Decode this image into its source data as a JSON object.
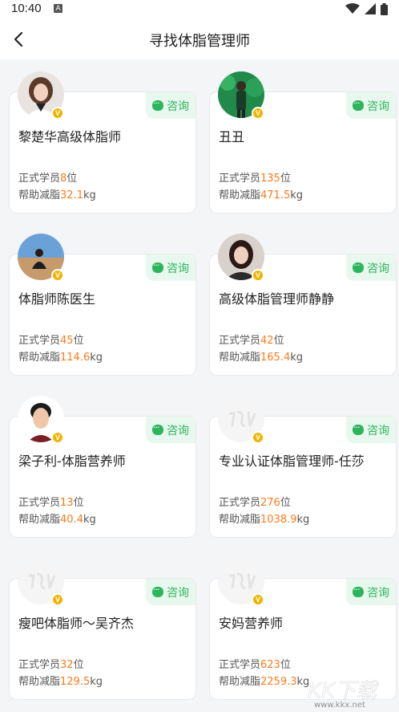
{
  "status": {
    "time": "10:40",
    "app_icon_letter": "A"
  },
  "header": {
    "title": "寻找体脂管理师"
  },
  "consult_label": "咨询",
  "labels": {
    "students_prefix": "正式学员",
    "students_suffix": "位",
    "help_prefix": "帮助减脂",
    "help_suffix": "kg"
  },
  "cards": [
    {
      "name": "黎楚华高级体脂师",
      "students": "8",
      "kg": "32.1"
    },
    {
      "name": "丑丑",
      "students": "135",
      "kg": "471.5"
    },
    {
      "name": "体脂师陈医生",
      "students": "45",
      "kg": "114.6"
    },
    {
      "name": "高级体脂管理师静静",
      "students": "42",
      "kg": "165.4"
    },
    {
      "name": "梁子利-体脂营养师",
      "students": "13",
      "kg": "40.4"
    },
    {
      "name": "专业认证体脂管理师-任莎",
      "students": "276",
      "kg": "1038.9"
    },
    {
      "name": "瘦吧体脂师～吴齐杰",
      "students": "32",
      "kg": "129.5"
    },
    {
      "name": "安妈营养师",
      "students": "623",
      "kg": "2259.3"
    }
  ],
  "watermark": {
    "text": "KK下载",
    "url": "www.kkx.net"
  },
  "colors": {
    "accent_orange": "#ff7a1a",
    "consult_green": "#2db55d",
    "badge_gold": "#f0b400"
  }
}
